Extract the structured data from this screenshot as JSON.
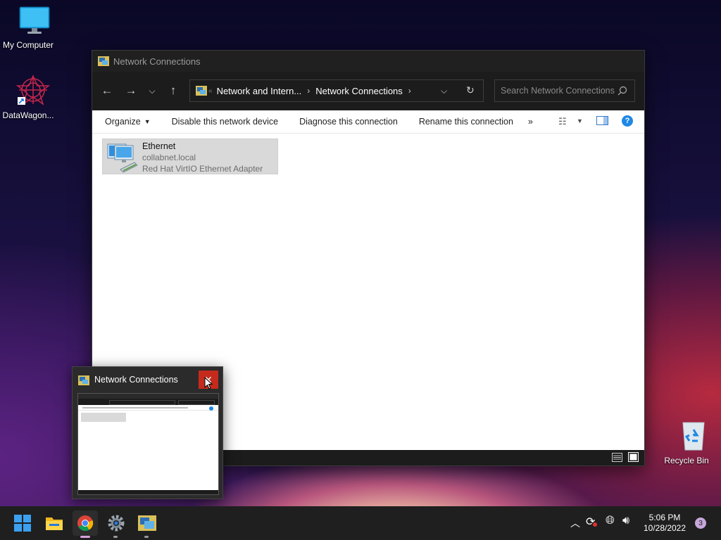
{
  "desktop": {
    "icons": [
      {
        "label": "My Computer"
      },
      {
        "label": "DataWagon..."
      },
      {
        "label": "Recycle Bin"
      }
    ]
  },
  "window": {
    "title": "Network Connections",
    "address": {
      "overflow": "«",
      "crumbs": [
        "Network and Intern...",
        "Network Connections"
      ]
    },
    "search_placeholder": "Search Network Connections",
    "commands": [
      "Organize",
      "Disable this network device",
      "Diagnose this connection",
      "Rename this connection",
      "»"
    ],
    "items": [
      {
        "name": "Ethernet",
        "network": "collabnet.local",
        "adapter": "Red Hat VirtIO Ethernet Adapter"
      }
    ]
  },
  "thumbnail": {
    "title": "Network Connections",
    "close_glyph": "✕"
  },
  "taskbar": {
    "apps": [
      "start-icon",
      "file-explorer-icon",
      "chrome-icon",
      "settings-icon",
      "network-connections-icon"
    ],
    "time": "5:06 PM",
    "date": "10/28/2022",
    "notifications": "3"
  },
  "colors": {
    "accent": "#0067c0",
    "help": "#1e88e5",
    "close": "#c42b1c",
    "selection": "#d9d9d9"
  }
}
